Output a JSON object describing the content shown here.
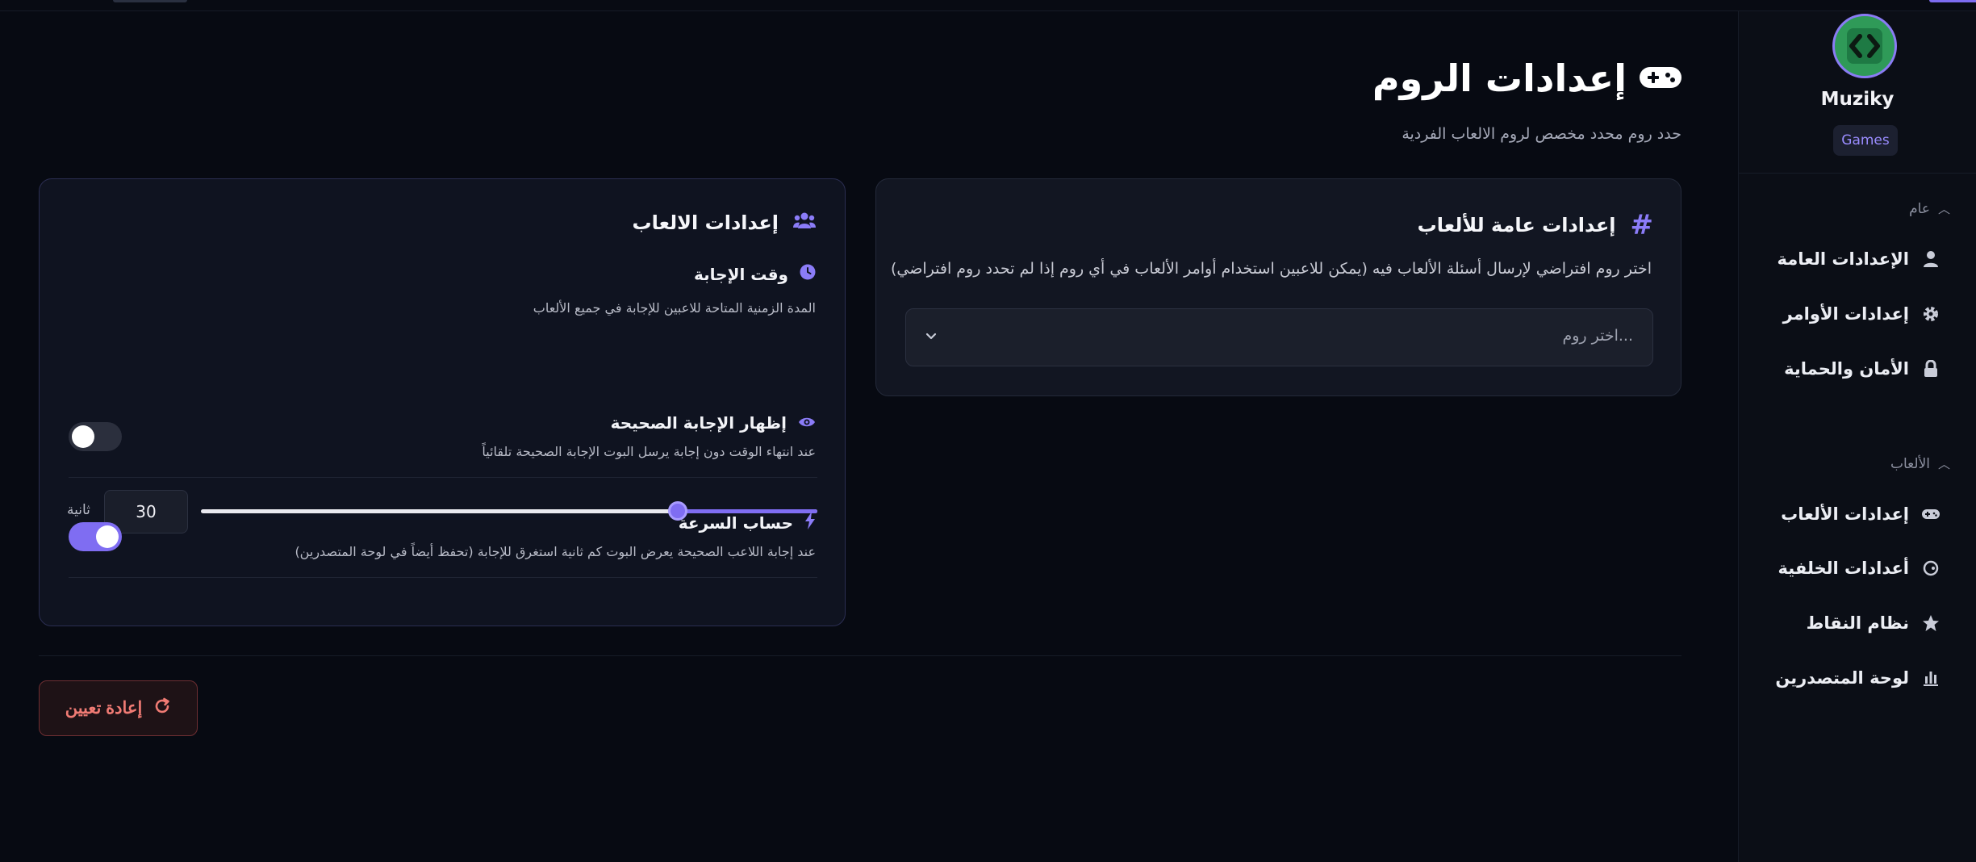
{
  "sidebar": {
    "bot_name": "Muziky",
    "badge": "Games",
    "sections": [
      {
        "label": "عام",
        "items": [
          {
            "label": "الإعدادات العامة",
            "icon": "user-icon"
          },
          {
            "label": "إعدادات الأوامر",
            "icon": "gear-icon"
          },
          {
            "label": "الأمان والحماية",
            "icon": "lock-icon"
          }
        ]
      },
      {
        "label": "الألعاب",
        "items": [
          {
            "label": "إعدادات الألعاب",
            "icon": "gamepad-icon"
          },
          {
            "label": "أعدادات الخلفية",
            "icon": "palette-icon"
          },
          {
            "label": "نظام النقاط",
            "icon": "star-icon"
          },
          {
            "label": "لوحة المتصدرين",
            "icon": "bar-chart-icon"
          }
        ]
      }
    ]
  },
  "page": {
    "title": "إعدادات الروم",
    "subtitle": "حدد روم محدد مخصص لروم الالعاب الفردية"
  },
  "general_card": {
    "title": "إعدادات عامة للألعاب",
    "description": "اختر روم افتراضي لإرسال أسئلة الألعاب فيه (يمكن للاعبين استخدام أوامر الألعاب في أي روم إذا لم تحدد روم افتراضي)",
    "select_placeholder": "اختر روم..."
  },
  "games_card": {
    "title": "إعدادات الالعاب",
    "answer_time": {
      "title": "وقت الإجابة",
      "description": "المدة الزمنية المتاحة للاعبين للإجابة في جميع الألعاب",
      "value": "30",
      "unit": "ثانية",
      "slider_fraction": 0.226
    },
    "show_answer": {
      "title": "إظهار الإجابة الصحيحة",
      "description": "عند انتهاء الوقت دون إجابة يرسل البوت الإجابة الصحيحة تلقائياً",
      "enabled": false
    },
    "speed_calc": {
      "title": "حساب السرعة",
      "description": "عند إجابة اللاعب الصحيحة يعرض البوت كم ثانية استغرق للإجابة (تحفظ أيضاً في لوحة المتصدرين)",
      "enabled": true
    }
  },
  "actions": {
    "reset_label": "إعادة تعيين"
  },
  "colors": {
    "accent": "#7f6df2",
    "background": "#070a12",
    "card": "#121622",
    "danger": "#f07b74"
  }
}
